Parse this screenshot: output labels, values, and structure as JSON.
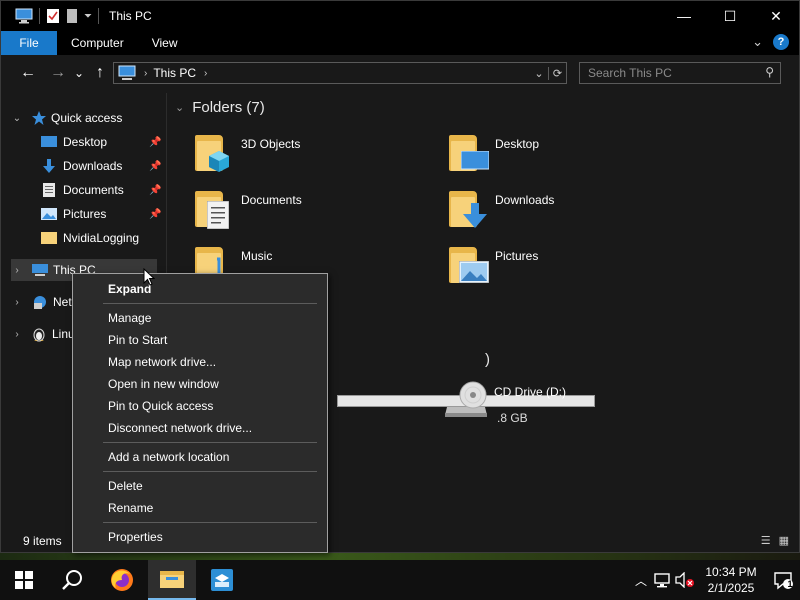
{
  "window": {
    "title": "This PC",
    "controls": {
      "minimize": "—",
      "maximize": "☐",
      "close": "✕"
    }
  },
  "ribbon": {
    "tabs": [
      "File",
      "Computer",
      "View"
    ],
    "expand_glyph": "⌄",
    "help": "?"
  },
  "navigation": {
    "back": "←",
    "forward": "→",
    "recent": "⌄",
    "up": "↑",
    "address": {
      "crumbs": [
        "This PC"
      ],
      "separator": "›"
    },
    "search": {
      "placeholder": "Search This PC"
    }
  },
  "sidebar": {
    "quick_access": "Quick access",
    "items": [
      {
        "label": "Desktop",
        "pinned": true
      },
      {
        "label": "Downloads",
        "pinned": true
      },
      {
        "label": "Documents",
        "pinned": true
      },
      {
        "label": "Pictures",
        "pinned": true
      },
      {
        "label": "NvidiaLogging",
        "pinned": false
      }
    ],
    "this_pc": "This PC",
    "network_partial": "Net",
    "linux_partial": "Linu"
  },
  "content": {
    "folders_header": "Folders (7)",
    "folders": [
      {
        "label": "3D Objects",
        "overlay": "cube"
      },
      {
        "label": "Desktop",
        "overlay": "monitor"
      },
      {
        "label": "Documents",
        "overlay": "document"
      },
      {
        "label": "Downloads",
        "overlay": "download-arrow"
      },
      {
        "label": "Music",
        "overlay": "music-note"
      },
      {
        "label": "Pictures",
        "overlay": "picture"
      }
    ],
    "devices_header_partial": ")",
    "drive_free_partial": ".8 GB",
    "cd_drive": "CD Drive (D:)"
  },
  "statusbar": {
    "item_count": "9 items"
  },
  "context_menu": {
    "groups": [
      [
        "Expand"
      ],
      [
        "Manage",
        "Pin to Start",
        "Map network drive...",
        "Open in new window",
        "Pin to Quick access",
        "Disconnect network drive..."
      ],
      [
        "Add a network location"
      ],
      [
        "Delete",
        "Rename"
      ],
      [
        "Properties"
      ]
    ]
  },
  "taskbar": {
    "clock_time": "10:34 PM",
    "clock_date": "2/1/2025",
    "notification_count": "1"
  },
  "colors": {
    "accent": "#1979ca",
    "folder": "#f7d27a",
    "window_bg": "#191919",
    "menu_bg": "#2b2b2b"
  }
}
